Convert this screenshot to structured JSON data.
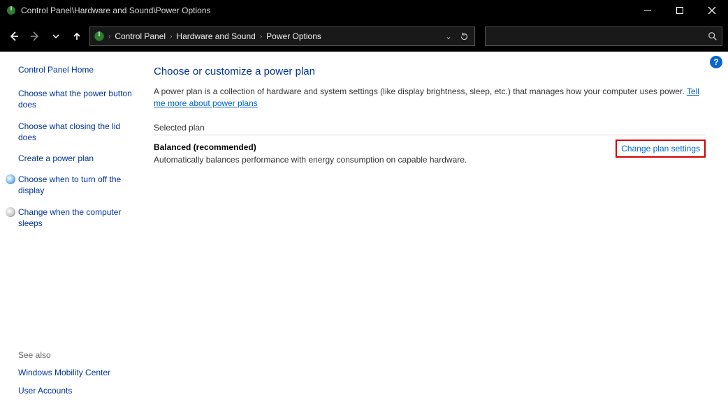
{
  "titlebar": {
    "title": "Control Panel\\Hardware and Sound\\Power Options"
  },
  "breadcrumb": {
    "seg1": "Control Panel",
    "seg2": "Hardware and Sound",
    "seg3": "Power Options"
  },
  "sidebar": {
    "home": "Control Panel Home",
    "item1": "Choose what the power button does",
    "item2": "Choose what closing the lid does",
    "item3": "Create a power plan",
    "item4": "Choose when to turn off the display",
    "item5": "Change when the computer sleeps",
    "seealso_label": "See also",
    "sa1": "Windows Mobility Center",
    "sa2": "User Accounts"
  },
  "content": {
    "heading": "Choose or customize a power plan",
    "desc_text": "A power plan is a collection of hardware and system settings (like display brightness, sleep, etc.) that manages how your computer uses power. ",
    "desc_link": "Tell me more about power plans",
    "section_label": "Selected plan",
    "plan_name": "Balanced (recommended)",
    "plan_desc": "Automatically balances performance with energy consumption on capable hardware.",
    "change_link": "Change plan settings"
  }
}
